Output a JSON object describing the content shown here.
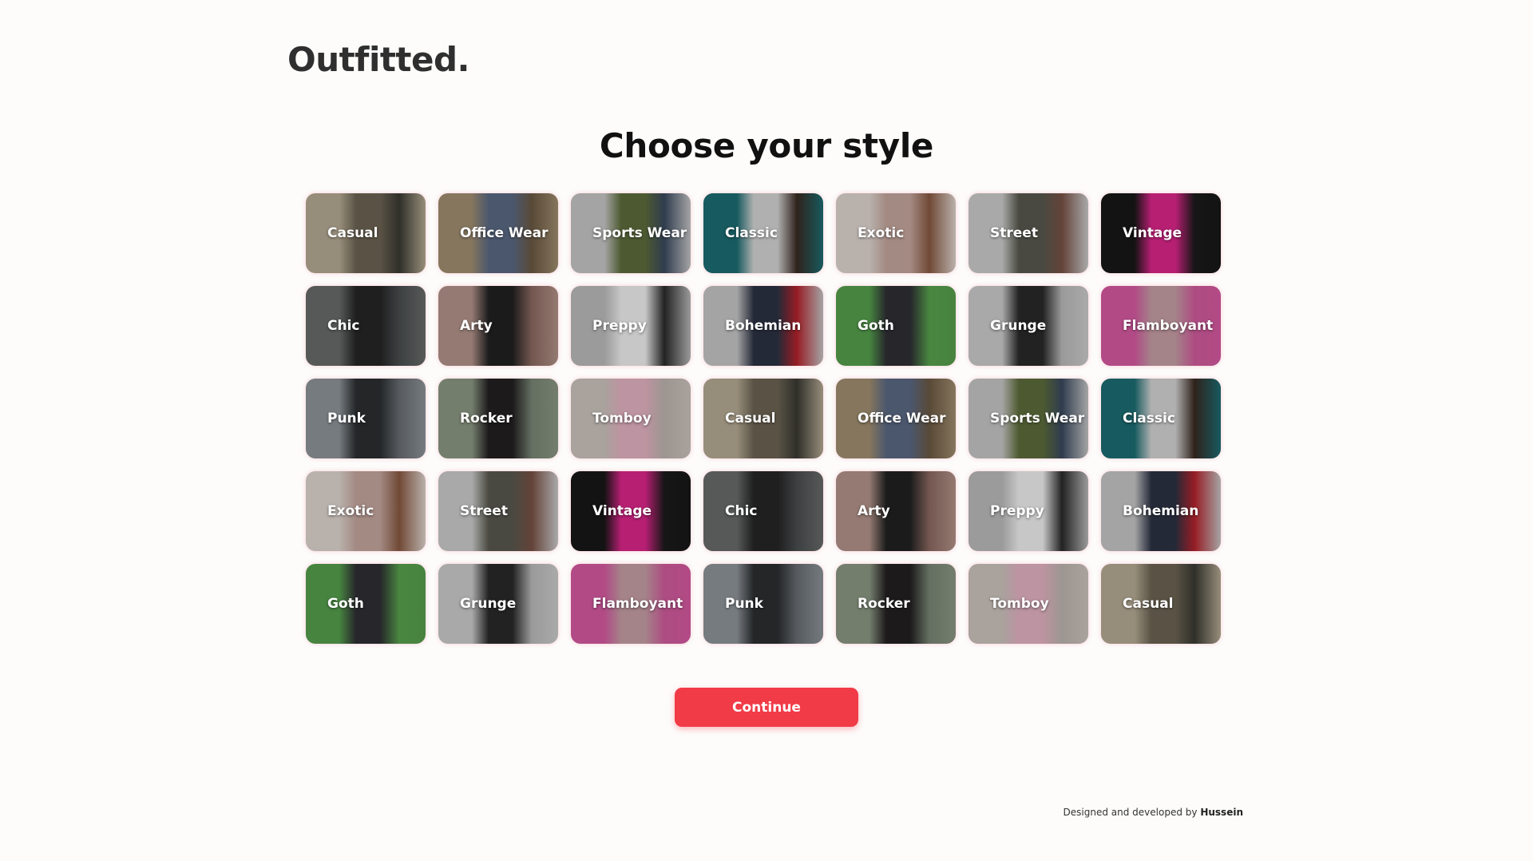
{
  "app": {
    "logo": "Outfitted."
  },
  "page": {
    "heading": "Choose your style"
  },
  "styles": [
    {
      "label": "Casual",
      "colors": [
        "#b9ad96",
        "#6e6655",
        "#3a3a33"
      ]
    },
    {
      "label": "Office Wear",
      "colors": [
        "#a39072",
        "#5c6b86",
        "#6d5a44"
      ]
    },
    {
      "label": "Sports Wear",
      "colors": [
        "#c9c9c9",
        "#5f6e3c",
        "#3a4a60"
      ]
    },
    {
      "label": "Classic",
      "colors": [
        "#1d6e74",
        "#d7d7d7",
        "#3a2a22"
      ]
    },
    {
      "label": "Exotic",
      "colors": [
        "#e2d8d2",
        "#c7a9a0",
        "#8a5a42"
      ]
    },
    {
      "label": "Street",
      "colors": [
        "#cfcfcf",
        "#5a5a50",
        "#7a5246"
      ]
    },
    {
      "label": "Vintage",
      "colors": [
        "#181818",
        "#e0268d",
        "#1b1b1b"
      ]
    },
    {
      "label": "Chic",
      "colors": [
        "#6b6d6d",
        "#262626",
        "#4b4f50"
      ]
    },
    {
      "label": "Arty",
      "colors": [
        "#b5958b",
        "#222222",
        "#8e6b62"
      ]
    },
    {
      "label": "Preppy",
      "colors": [
        "#bdbdbd",
        "#f3f3f3",
        "#2a2a2a"
      ]
    },
    {
      "label": "Bohemian",
      "colors": [
        "#c9c9c9",
        "#2d3345",
        "#b8232c"
      ]
    },
    {
      "label": "Goth",
      "colors": [
        "#57a24f",
        "#2f2f35",
        "#5aa44f"
      ]
    },
    {
      "label": "Grunge",
      "colors": [
        "#cfcfcf",
        "#2a2a2a",
        "#bdbdbd"
      ]
    },
    {
      "label": "Flamboyant",
      "colors": [
        "#d95ba4",
        "#c9a0a8",
        "#d45d9f"
      ]
    },
    {
      "label": "Punk",
      "colors": [
        "#8f969c",
        "#2c2f31",
        "#6a6f74"
      ]
    },
    {
      "label": "Rocker",
      "colors": [
        "#8e9a86",
        "#232022",
        "#7b8877"
      ]
    },
    {
      "label": "Tomboy",
      "colors": [
        "#cfc6c0",
        "#e7b5c5",
        "#bfb7b1"
      ]
    },
    {
      "label": "Casual",
      "colors": [
        "#b9ad96",
        "#6e6655",
        "#3a3a33"
      ]
    },
    {
      "label": "Office Wear",
      "colors": [
        "#a39072",
        "#5c6b86",
        "#6d5a44"
      ]
    },
    {
      "label": "Sports Wear",
      "colors": [
        "#c9c9c9",
        "#5f6e3c",
        "#3a4a60"
      ]
    },
    {
      "label": "Classic",
      "colors": [
        "#1d6e74",
        "#d7d7d7",
        "#3a2a22"
      ]
    },
    {
      "label": "Exotic",
      "colors": [
        "#e2d8d2",
        "#c7a9a0",
        "#8a5a42"
      ]
    },
    {
      "label": "Street",
      "colors": [
        "#cfcfcf",
        "#5a5a50",
        "#7a5246"
      ]
    },
    {
      "label": "Vintage",
      "colors": [
        "#181818",
        "#e0268d",
        "#1b1b1b"
      ]
    },
    {
      "label": "Chic",
      "colors": [
        "#6b6d6d",
        "#262626",
        "#4b4f50"
      ]
    },
    {
      "label": "Arty",
      "colors": [
        "#b5958b",
        "#222222",
        "#8e6b62"
      ]
    },
    {
      "label": "Preppy",
      "colors": [
        "#bdbdbd",
        "#f3f3f3",
        "#2a2a2a"
      ]
    },
    {
      "label": "Bohemian",
      "colors": [
        "#c9c9c9",
        "#2d3345",
        "#b8232c"
      ]
    },
    {
      "label": "Goth",
      "colors": [
        "#57a24f",
        "#2f2f35",
        "#5aa44f"
      ]
    },
    {
      "label": "Grunge",
      "colors": [
        "#cfcfcf",
        "#2a2a2a",
        "#bdbdbd"
      ]
    },
    {
      "label": "Flamboyant",
      "colors": [
        "#d95ba4",
        "#c9a0a8",
        "#d45d9f"
      ]
    },
    {
      "label": "Punk",
      "colors": [
        "#8f969c",
        "#2c2f31",
        "#6a6f74"
      ]
    },
    {
      "label": "Rocker",
      "colors": [
        "#8e9a86",
        "#232022",
        "#7b8877"
      ]
    },
    {
      "label": "Tomboy",
      "colors": [
        "#cfc6c0",
        "#e7b5c5",
        "#bfb7b1"
      ]
    },
    {
      "label": "Casual",
      "colors": [
        "#b9ad96",
        "#6e6655",
        "#3a3a33"
      ]
    }
  ],
  "actions": {
    "continue_label": "Continue"
  },
  "footer": {
    "prefix": "Designed and developed by",
    "author": "Hussein"
  },
  "theme": {
    "accent": "#f13b47",
    "background": "#fdfcfb"
  }
}
